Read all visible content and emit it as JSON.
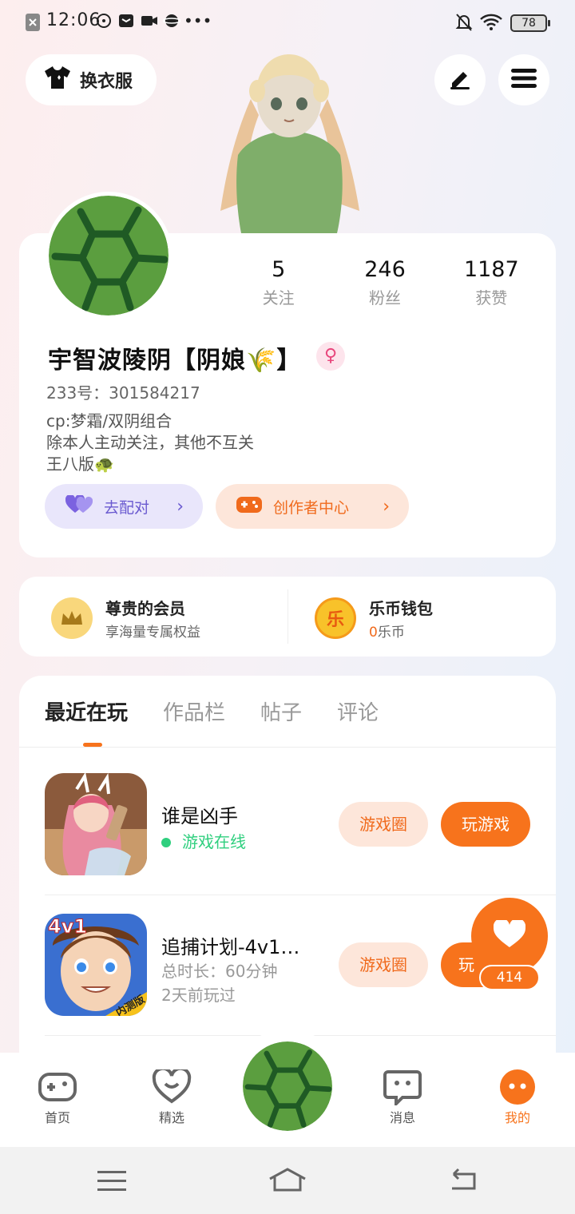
{
  "status_bar": {
    "time": "12:06",
    "battery": "78"
  },
  "header": {
    "outfit_label": "换衣服"
  },
  "profile": {
    "stats": [
      {
        "num": "5",
        "label": "关注"
      },
      {
        "num": "246",
        "label": "粉丝"
      },
      {
        "num": "1187",
        "label": "获赞"
      }
    ],
    "username": "宇智波陵阴【阴娘🌾】",
    "gender_symbol": "♀",
    "uid": "233号：301584217",
    "bio": [
      "cp:梦霜/双阴组合",
      "除本人主动关注，其他不互关",
      "王八版🐢"
    ],
    "match_label": "去配对",
    "creator_label": "创作者中心"
  },
  "wallet": {
    "vip_title": "尊贵的会员",
    "vip_sub": "享海量专属权益",
    "coin_char": "乐",
    "coin_title": "乐币钱包",
    "coin_amount": "0",
    "coin_unit": "乐币"
  },
  "tabs": [
    "最近在玩",
    "作品栏",
    "帖子",
    "评论"
  ],
  "games": [
    {
      "title": "谁是凶手",
      "status": "游戏在线",
      "circle_label": "游戏圈",
      "play_label": "玩游戏"
    },
    {
      "title": "追捕计划-4v1…",
      "icon_badge": "4v1",
      "icon_tag": "内测版",
      "duration": "总时长：60分钟",
      "last_played": "2天前玩过",
      "circle_label": "游戏圈",
      "play_label": "玩"
    }
  ],
  "fab": {
    "count": "414"
  },
  "nav": [
    {
      "label": "首页"
    },
    {
      "label": "精选"
    },
    {
      "label": "消息"
    },
    {
      "label": "我的"
    }
  ],
  "colors": {
    "accent": "#f7731c",
    "online": "#2fcf7e",
    "turtle_green": "#5b9e3f"
  }
}
